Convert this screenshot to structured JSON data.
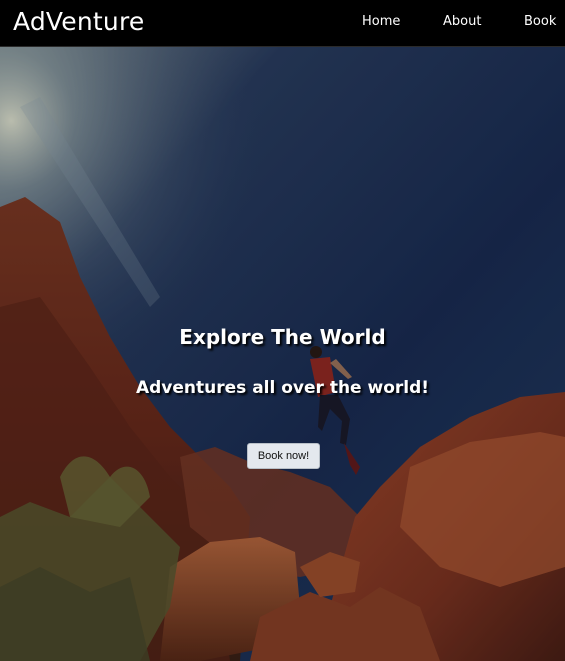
{
  "nav": {
    "brand": "AdVenture",
    "links": [
      "Home",
      "About",
      "Book"
    ]
  },
  "hero": {
    "title": "Explore The World",
    "subtitle": "Adventures all over the world!",
    "button_label": "Book now!"
  },
  "colors": {
    "navbar_bg": "#000000",
    "text": "#ffffff",
    "button_bg": "#e4e8ee",
    "sky": "#1b2b52",
    "rock": "#8a3a22"
  }
}
